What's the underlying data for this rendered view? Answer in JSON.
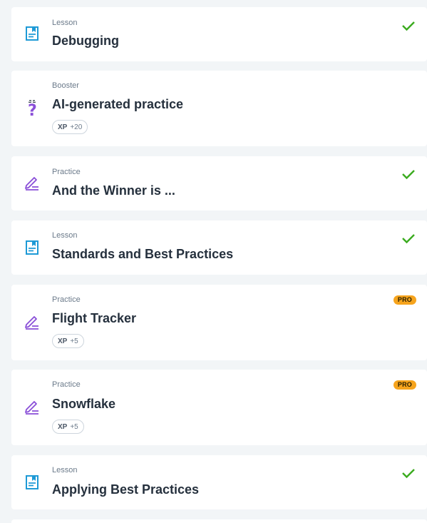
{
  "items": [
    {
      "type": "Lesson",
      "title": "Debugging",
      "icon": "lesson-icon",
      "completed": true
    },
    {
      "type": "Booster",
      "title": "AI-generated practice",
      "icon": "booster-question-icon",
      "xp_label": "XP",
      "xp_value": "+20"
    },
    {
      "type": "Practice",
      "title": "And the Winner is ...",
      "icon": "practice-pencil-icon",
      "completed": true
    },
    {
      "type": "Lesson",
      "title": "Standards and Best Practices",
      "icon": "lesson-icon",
      "completed": true
    },
    {
      "type": "Practice",
      "title": "Flight Tracker",
      "icon": "practice-pencil-icon",
      "badge": "PRO",
      "xp_label": "XP",
      "xp_value": "+5"
    },
    {
      "type": "Practice",
      "title": "Snowflake",
      "icon": "practice-pencil-icon",
      "badge": "PRO",
      "xp_label": "XP",
      "xp_value": "+5"
    },
    {
      "type": "Lesson",
      "title": "Applying Best Practices",
      "icon": "lesson-icon",
      "completed": true
    }
  ],
  "colors": {
    "lesson_icon": "#1e9ad6",
    "practice_icon": "#8a4fd8",
    "check": "#3bab1f",
    "pro_badge": "#f6a41d",
    "background": "#f2f5f7"
  }
}
